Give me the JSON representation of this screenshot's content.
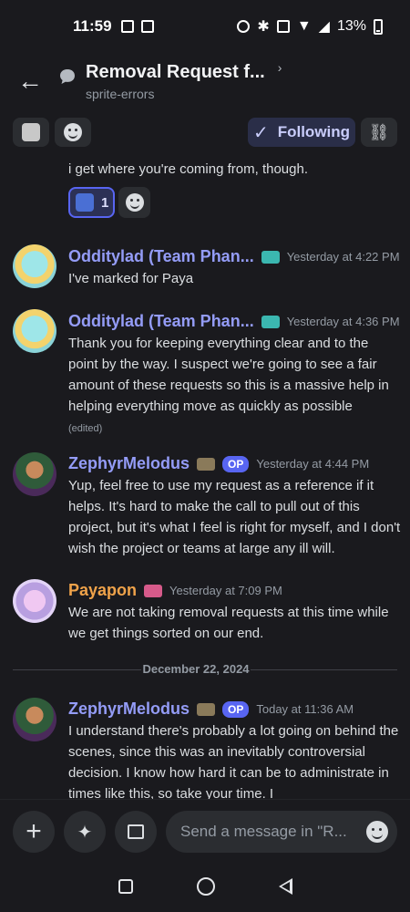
{
  "status_bar": {
    "time": "11:59",
    "battery": "13%"
  },
  "header": {
    "title": "Removal Request f...",
    "subtitle": "sprite-errors"
  },
  "toolbar": {
    "following_label": "Following"
  },
  "continuation": {
    "text": "i get where you're coming from, though.",
    "reaction_count": "1"
  },
  "messages": [
    {
      "author": "Odditylad (Team Phan...",
      "time": "Yesterday at 4:22 PM",
      "body": "I've marked for Paya"
    },
    {
      "author": "Odditylad (Team Phan...",
      "time": "Yesterday at 4:36 PM",
      "body": "Thank you for keeping everything clear and to the point by the way. I suspect we're going to see a fair amount of these requests so this is a massive help in helping everything move as quickly as possible",
      "edited": "(edited)"
    },
    {
      "author": "ZephyrMelodus",
      "badge": "OP",
      "time": "Yesterday at 4:44 PM",
      "body": "Yup, feel free to use my request as a reference if it helps. It's hard to make the call to pull out of this project, but it's what I feel is right for myself, and I don't wish the project or teams at large any ill will."
    },
    {
      "author": "Payapon",
      "time": "Yesterday at 7:09 PM",
      "body": "We are not taking removal requests at this time while we get things sorted on our end."
    },
    {
      "author": "ZephyrMelodus",
      "badge": "OP",
      "time": "Today at 11:36 AM",
      "body": "I understand there's probably a lot going on behind the scenes, since this was an inevitably controversial decision. I know how hard it can be to administrate in times like this, so take your time. I"
    }
  ],
  "divider": {
    "date": "December 22, 2024"
  },
  "composer": {
    "placeholder": "Send a message in \"R..."
  },
  "colors": {
    "background": "#1a1a1e",
    "accent": "#5865f2",
    "username_blue": "#949cf7",
    "username_orange": "#f0a34a"
  }
}
